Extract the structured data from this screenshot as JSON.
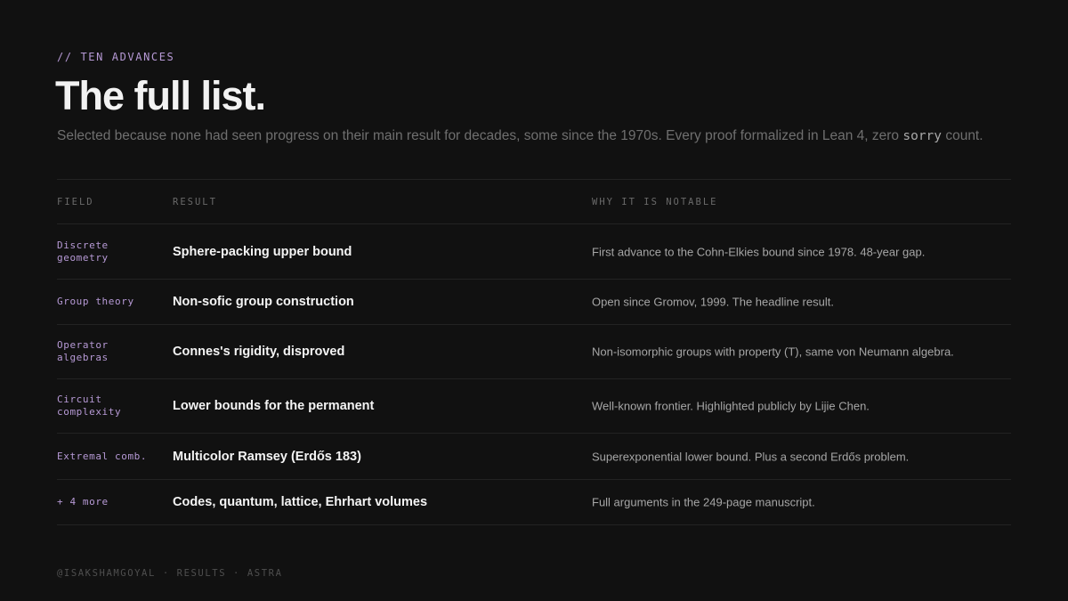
{
  "eyebrow": "// TEN ADVANCES",
  "title": "The full list.",
  "subtitle": {
    "before": "Selected because none had seen progress on their main result for decades, some since the 1970s. Every proof formalized in Lean 4, zero ",
    "code": "sorry",
    "after": " count."
  },
  "table": {
    "headers": {
      "field": "FIELD",
      "result": "RESULT",
      "why": "WHY IT IS NOTABLE"
    },
    "rows": [
      {
        "field": "Discrete geometry",
        "result": "Sphere-packing upper bound",
        "why": "First advance to the Cohn-Elkies bound since 1978. 48-year gap."
      },
      {
        "field": "Group theory",
        "result": "Non-sofic group construction",
        "why": "Open since Gromov, 1999. The headline result."
      },
      {
        "field": "Operator algebras",
        "result": "Connes's rigidity, disproved",
        "why": "Non-isomorphic groups with property (T), same von Neumann algebra."
      },
      {
        "field": "Circuit complexity",
        "result": "Lower bounds for the permanent",
        "why": "Well-known frontier. Highlighted publicly by Lijie Chen."
      },
      {
        "field": "Extremal comb.",
        "result": "Multicolor Ramsey (Erdős 183)",
        "why": "Superexponential lower bound. Plus a second Erdős problem."
      },
      {
        "field": "+ 4 more",
        "result": "Codes, quantum, lattice, Ehrhart volumes",
        "why": "Full arguments in the 249-page manuscript."
      }
    ]
  },
  "footer": "@ISAKSHAMGOYAL · RESULTS · ASTRA",
  "colors": {
    "background": "#111111",
    "accent": "#b79ad6",
    "title": "#f2f2f2",
    "muted": "#6f6f6f",
    "divider": "#232323"
  }
}
